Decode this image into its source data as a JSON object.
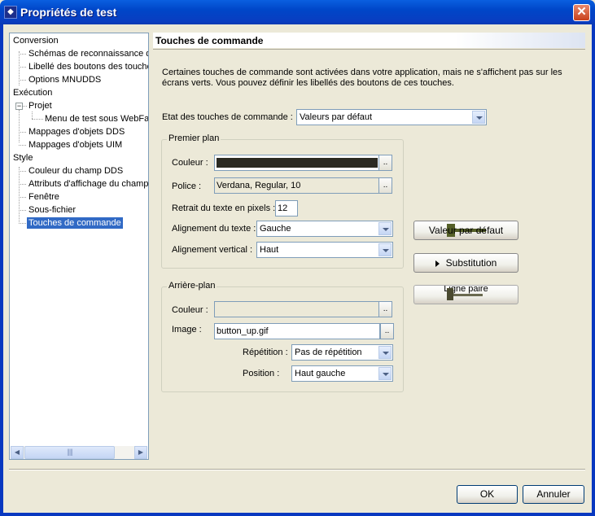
{
  "window": {
    "title": "Propriétés de test",
    "close_glyph": "✕",
    "app_icon": "app-icon"
  },
  "tree": {
    "conversion": "Conversion",
    "schemas": "Schémas de reconnaissance d",
    "libelle_boutons": "Libellé des boutons des touche",
    "options": "Options MNUDDS",
    "execution": "Exécution",
    "projet": "Projet",
    "expander_glyph": "−",
    "menu_test": "Menu de test sous WebFa",
    "mappages_dds": "Mappages d'objets DDS",
    "mappages_uim": "Mappages d'objets UIM",
    "style": "Style",
    "couleur_champ": "Couleur du champ DDS",
    "attributs": "Attributs d'affichage du champ",
    "fenetre": "Fenêtre",
    "sous_fichier": "Sous-fichier",
    "touches": "Touches de commande",
    "scroll_left": "◀",
    "scroll_right": "▶",
    "scroll_grip": "|||||"
  },
  "panel": {
    "title": "Touches de commande",
    "description": "Certaines touches de commande sont activées dans votre application, mais ne s'affichent pas sur les écrans verts.  Vous pouvez définir les libellés des boutons de ces touches.",
    "etat_label": "Etat des touches de commande :",
    "etat_value": "Valeurs par défaut"
  },
  "premier_plan": {
    "title": "Premier plan",
    "couleur_label": "Couleur :",
    "couleur_swatch": "#2b2a22",
    "browse_label": "..",
    "police_label": "Police :",
    "police_value": "Verdana, Regular, 10",
    "retrait_label": "Retrait du texte en pixels :",
    "retrait_value": "12",
    "alignement_texte_label": "Alignement du texte :",
    "alignement_texte_value": "Gauche",
    "alignement_vertical_label": "Alignement vertical :",
    "alignement_vertical_value": "Haut"
  },
  "arriere_plan": {
    "title": "Arrière-plan",
    "couleur_label": "Couleur :",
    "image_label": "Image :",
    "image_value": "button_up.gif",
    "repetition_label": "Répétition :",
    "repetition_value": "Pas de répétition",
    "position_label": "Position :",
    "position_value": "Haut gauche"
  },
  "preview": {
    "valeur_label": "Valeur par défaut",
    "substitution_label": "Substitution",
    "ligne_paire_label": "Ligne paire"
  },
  "footer": {
    "ok_label": "OK",
    "cancel_label": "Annuler"
  }
}
